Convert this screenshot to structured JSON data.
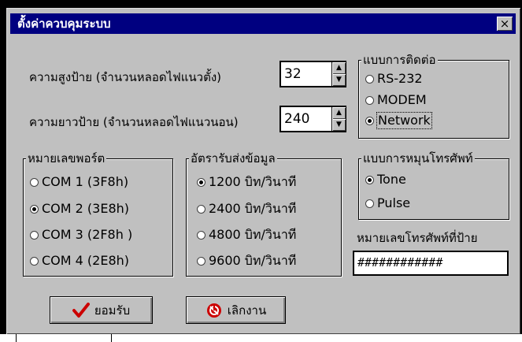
{
  "window": {
    "title": "ตั้งค่าควบคุมระบบ",
    "close_label": "×"
  },
  "height": {
    "label": "ความสูงป้าย (จำนวนหลอดไฟแนวตั้ง)",
    "value": "32"
  },
  "width": {
    "label": "ความยาวป้าย (จำนวนหลอดไฟแนวนอน)",
    "value": "240"
  },
  "connection": {
    "title": "แบบการติดต่อ",
    "options": [
      "RS-232",
      "MODEM",
      "Network"
    ],
    "selected": 2
  },
  "port": {
    "title": "หมายเลขพอร์ต",
    "options": [
      "COM 1  (3F8h)",
      "COM 2  (3E8h)",
      "COM 3  (2F8h )",
      "COM 4  (2E8h)"
    ],
    "selected": 1
  },
  "baud": {
    "title": "อัตรารับส่งข้อมูล",
    "options": [
      "1200  บิท/วินาที",
      "2400  บิท/วินาที",
      "4800  บิท/วินาที",
      "9600  บิท/วินาที"
    ],
    "selected": 0
  },
  "dial": {
    "title": "แบบการหมุนโทรศัพท์",
    "options": [
      "Tone",
      "Pulse"
    ],
    "selected": 0
  },
  "phone": {
    "label": "หมายเลขโทรศัพท์ที่ป้าย",
    "value": "############"
  },
  "buttons": {
    "ok": "ยอมรับ",
    "cancel": "เลิกงาน"
  },
  "colors": {
    "title_bg": "#000080",
    "face": "#c0c0c0",
    "ok_check": "#cc0000",
    "cancel_icon": "#cc0000"
  }
}
